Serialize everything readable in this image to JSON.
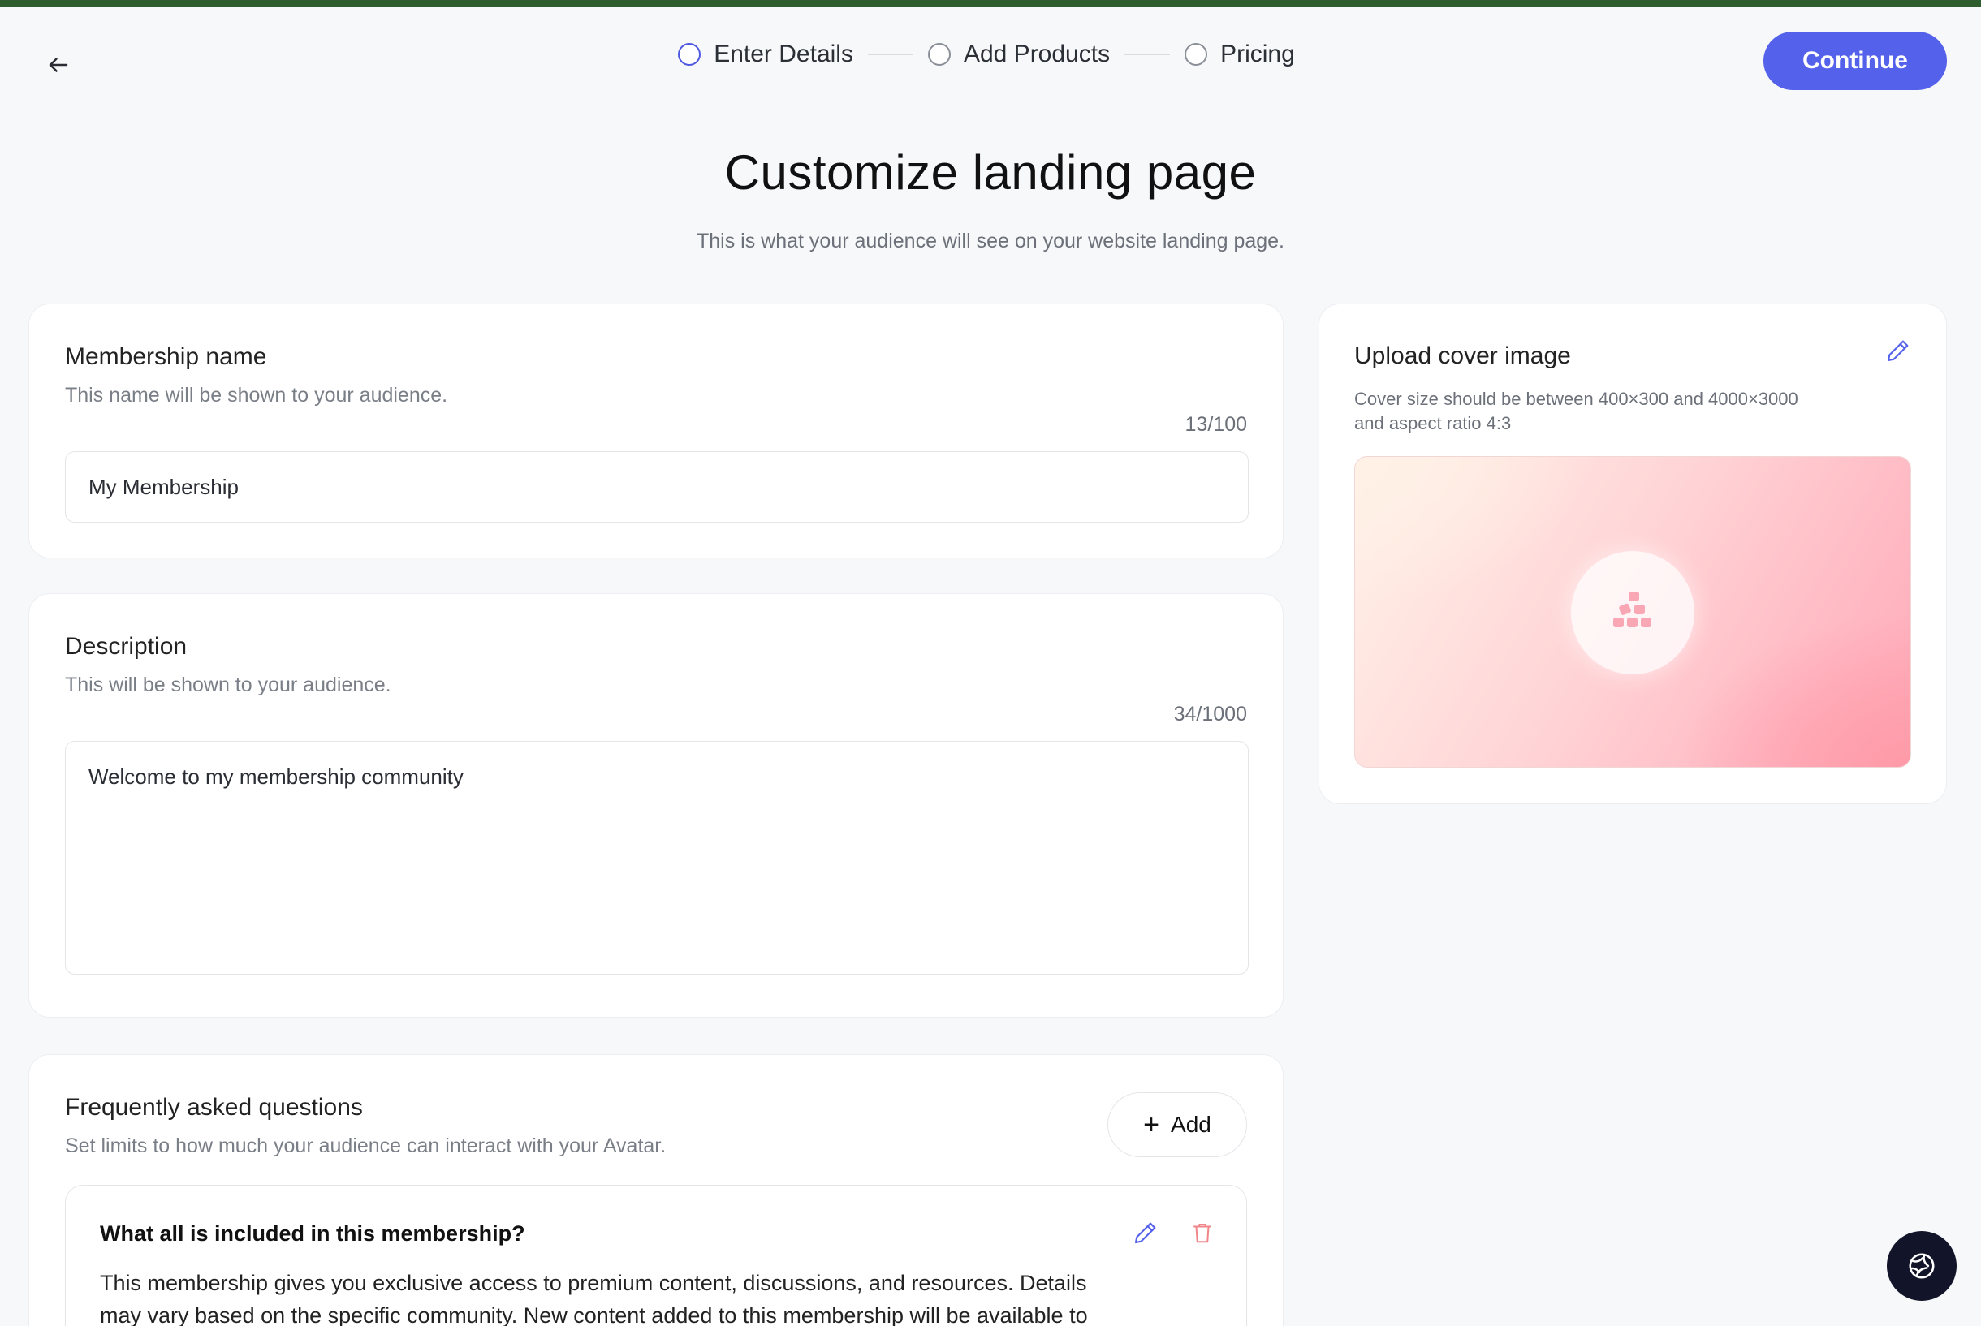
{
  "header": {
    "steps": [
      {
        "label": "Enter Details",
        "state": "active"
      },
      {
        "label": "Add Products",
        "state": "pending"
      },
      {
        "label": "Pricing",
        "state": "pending"
      }
    ],
    "continue_label": "Continue"
  },
  "page": {
    "title": "Customize landing page",
    "subtitle": "This is what your audience will see on your website landing page."
  },
  "membership_name": {
    "title": "Membership name",
    "hint": "This name will be shown to your audience.",
    "counter": "13/100",
    "value": "My Membership"
  },
  "description": {
    "title": "Description",
    "hint": "This will be shown to your audience.",
    "counter": "34/1000",
    "value": "Welcome to my membership community"
  },
  "faq": {
    "title": "Frequently asked questions",
    "hint": "Set limits to how much your audience can interact with your Avatar.",
    "add_label": "Add",
    "items": [
      {
        "question": "What all is included in this membership?",
        "answer": "This membership gives you exclusive access to premium content, discussions, and resources. Details may vary based on the specific community. New content added to this membership will be available to"
      }
    ]
  },
  "cover": {
    "title": "Upload cover image",
    "hint_line1": "Cover size should be between 400×300 and 4000×3000",
    "hint_line2": "and aspect ratio 4:3"
  },
  "icons": {
    "back": "arrow-left-icon",
    "edit": "pencil-icon",
    "delete": "trash-icon",
    "placeholder": "blocks-icon",
    "help": "globe-icon"
  },
  "colors": {
    "accent": "#5461ea",
    "top_bar": "#2e5e2e",
    "delete": "#f0868a",
    "fab": "#12152a"
  }
}
